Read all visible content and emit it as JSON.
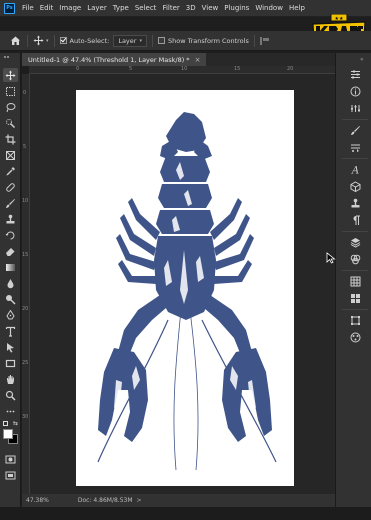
{
  "app": {
    "logo_text": "Ps",
    "menus": [
      "File",
      "Edit",
      "Image",
      "Layer",
      "Type",
      "Select",
      "Filter",
      "3D",
      "View",
      "Plugins",
      "Window",
      "Help"
    ]
  },
  "watermark": {
    "text": "KRAPPXXT",
    "colors": {
      "fill": "#f2c200",
      "outline": "#111111"
    }
  },
  "options": {
    "auto_select_label": "Auto-Select:",
    "auto_select_checked": true,
    "auto_select_target": "Layer",
    "transform_controls_label": "Show Transform Controls",
    "transform_controls_checked": false
  },
  "document": {
    "tab_title": "Untitled-1 @ 47.4% (Threshold 1, Layer Mask/8) *",
    "close_glyph": "×"
  },
  "rulers": {
    "top_numbers": [
      "0",
      "5",
      "10",
      "15",
      "20"
    ],
    "left_numbers": [
      "0",
      "5",
      "10",
      "15",
      "20",
      "25",
      "30"
    ]
  },
  "status": {
    "zoom": "47.38%",
    "doc_size": "Doc: 4.86M/8.53M",
    "arrow": ">"
  },
  "colors": {
    "app_bg": "#1e1e1e",
    "panel_bg": "#323232",
    "canvas_bg": "#262626",
    "lobster": "#3f5488",
    "document_bg": "#ffffff"
  },
  "tools": [
    "move-tool-icon",
    "marquee-tool-icon",
    "lasso-tool-icon",
    "quick-select-tool-icon",
    "crop-tool-icon",
    "frame-tool-icon",
    "eyedropper-tool-icon",
    "healing-brush-tool-icon",
    "brush-tool-icon",
    "clone-stamp-tool-icon",
    "history-brush-tool-icon",
    "eraser-tool-icon",
    "gradient-tool-icon",
    "blur-tool-icon",
    "dodge-tool-icon",
    "pen-tool-icon",
    "type-tool-icon",
    "path-select-tool-icon",
    "rectangle-tool-icon",
    "hand-tool-icon",
    "zoom-tool-icon",
    "more-tools-icon"
  ],
  "right_panels": [
    "properties-panel-icon",
    "info-panel-icon",
    "adjustments-panel-icon",
    "brush-settings-panel-icon",
    "brushes-panel-icon",
    "character-panel-icon",
    "3d-panel-icon",
    "clone-source-panel-icon",
    "paragraph-panel-icon",
    "layers-panel-icon",
    "channels-panel-icon",
    "swatches-panel-icon",
    "libraries-panel-icon",
    "paths-panel-icon",
    "timeline-panel-icon"
  ]
}
